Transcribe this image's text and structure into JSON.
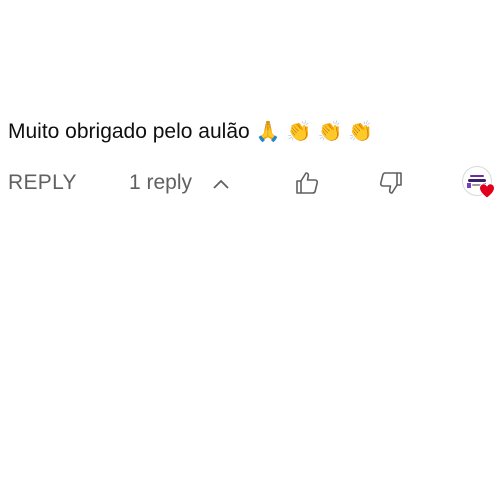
{
  "comment": {
    "text": "Muito obrigado pelo aulão",
    "emojis": [
      "🙏",
      "👏",
      "👏",
      "👏"
    ]
  },
  "actions": {
    "reply_label": "REPLY",
    "replies_label": "1 reply"
  },
  "icons": {
    "expand": "chevron-up-icon",
    "like": "thumbs-up-icon",
    "dislike": "thumbs-down-icon",
    "creator_heart": "creator-heart-icon"
  },
  "colors": {
    "text_primary": "#0f0f0f",
    "text_secondary": "#606060",
    "heart": "#e0001b"
  }
}
